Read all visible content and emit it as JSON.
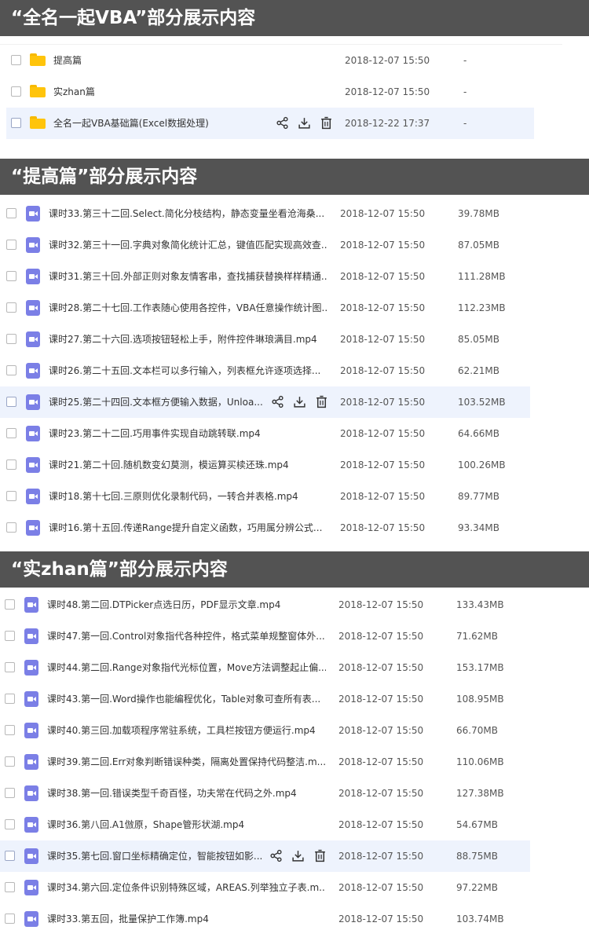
{
  "sections": [
    {
      "title": "“全名一起VBA”部分展示内容",
      "rows": [
        {
          "name": "提高篇",
          "date": "2018-12-07 15:50",
          "size": "-"
        },
        {
          "name": "实zhan篇",
          "date": "2018-12-07 15:50",
          "size": "-"
        },
        {
          "name": "全名一起VBA基础篇(Excel数据处理)",
          "date": "2018-12-22 17:37",
          "size": "-"
        }
      ]
    },
    {
      "title": "“提高篇”部分展示内容",
      "rows": [
        {
          "name": "课时33.第三十二回.Select.简化分枝结构，静态变量坐看沧海桑...",
          "date": "2018-12-07 15:50",
          "size": "39.78MB"
        },
        {
          "name": "课时32.第三十一回.字典对象简化统计汇总，键值匹配实现高效查...",
          "date": "2018-12-07 15:50",
          "size": "87.05MB"
        },
        {
          "name": "课时31.第三十回.外部正则对象友情客串，查找捕获替换样样精通...",
          "date": "2018-12-07 15:50",
          "size": "111.28MB"
        },
        {
          "name": "课时28.第二十七回.工作表随心使用各控件，VBA任意操作统计图...",
          "date": "2018-12-07 15:50",
          "size": "112.23MB"
        },
        {
          "name": "课时27.第二十六回.选项按钮轻松上手，附件控件琳琅满目.mp4",
          "date": "2018-12-07 15:50",
          "size": "85.05MB"
        },
        {
          "name": "课时26.第二十五回.文本栏可以多行输入，列表框允许逐项选择...",
          "date": "2018-12-07 15:50",
          "size": "62.21MB"
        },
        {
          "name": "课时25.第二十四回.文本框方便输入数据，Unloa...",
          "date": "2018-12-07 15:50",
          "size": "103.52MB"
        },
        {
          "name": "课时23.第二十二回.巧用事件实现自动跳转联.mp4",
          "date": "2018-12-07 15:50",
          "size": "64.66MB"
        },
        {
          "name": "课时21.第二十回.随机数变幻莫测，模运算买椟还珠.mp4",
          "date": "2018-12-07 15:50",
          "size": "100.26MB"
        },
        {
          "name": "课时18.第十七回.三原则优化录制代码，一转合并表格.mp4",
          "date": "2018-12-07 15:50",
          "size": "89.77MB"
        },
        {
          "name": "课时16.第十五回.传递Range提升自定义函数，巧用属分辨公式...",
          "date": "2018-12-07 15:50",
          "size": "93.34MB"
        }
      ]
    },
    {
      "title": "“实zhan篇”部分展示内容",
      "rows": [
        {
          "name": "课时48.第二回.DTPicker点选日历，PDF显示文章.mp4",
          "date": "2018-12-07 15:50",
          "size": "133.43MB"
        },
        {
          "name": "课时47.第一回.Control对象指代各种控件，格式菜单规整窗体外...",
          "date": "2018-12-07 15:50",
          "size": "71.62MB"
        },
        {
          "name": "课时44.第二回.Range对象指代光标位置，Move方法调整起止偏...",
          "date": "2018-12-07 15:50",
          "size": "153.17MB"
        },
        {
          "name": "课时43.第一回.Word操作也能编程优化，Table对象可查所有表...",
          "date": "2018-12-07 15:50",
          "size": "108.95MB"
        },
        {
          "name": "课时40.第三回.加载项程序常驻系统，工具栏按钮方便运行.mp4",
          "date": "2018-12-07 15:50",
          "size": "66.70MB"
        },
        {
          "name": "课时39.第二回.Err对象判断错误种类，隔离处置保持代码整洁.m...",
          "date": "2018-12-07 15:50",
          "size": "110.06MB"
        },
        {
          "name": "课时38.第一回.错误类型千奇百怪，功夫常在代码之外.mp4",
          "date": "2018-12-07 15:50",
          "size": "127.38MB"
        },
        {
          "name": "课时36.第八回.A1倣原，Shape管形状湖.mp4",
          "date": "2018-12-07 15:50",
          "size": "54.67MB"
        },
        {
          "name": "课时35.第七回.窗口坐标精确定位，智能按钮如影...",
          "date": "2018-12-07 15:50",
          "size": "88.75MB"
        },
        {
          "name": "课时34.第六回.定位条件识别特殊区域，AREAS.列举独立子表.m...",
          "date": "2018-12-07 15:50",
          "size": "97.22MB"
        },
        {
          "name": "课时33.第五回，批量保护工作簿.mp4",
          "date": "2018-12-07 15:50",
          "size": "103.74MB"
        }
      ]
    }
  ],
  "icons": {
    "folder": "folder-icon",
    "video": "video-file-icon",
    "share": "share-icon",
    "download": "download-icon",
    "delete": "trash-icon"
  },
  "colors": {
    "header_bg": "#535353",
    "hover_bg": "#eef3fd",
    "folder": "#ffc40b",
    "video": "#7b7fe6"
  }
}
